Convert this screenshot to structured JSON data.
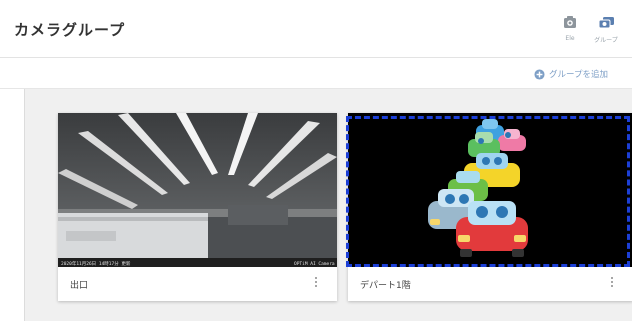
{
  "header": {
    "title": "カメラグループ",
    "camera_icon_label": "Ele",
    "group_icon_label": "グループ"
  },
  "toolbar": {
    "add_group_label": "グループを追加"
  },
  "cards": [
    {
      "name": "出口",
      "timestamp": "2020年11月26日 14時17分 更新",
      "watermark": "OPTiM AI Camera"
    },
    {
      "name": "デパート1階"
    }
  ],
  "colors": {
    "accent": "#7e9fc6",
    "selection": "#1c3fd6"
  }
}
